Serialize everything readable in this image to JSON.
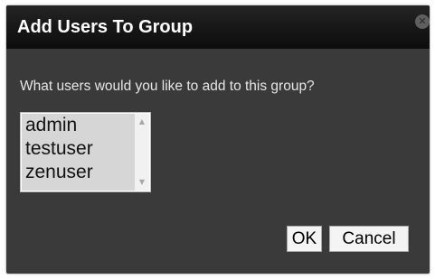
{
  "dialog": {
    "title": "Add Users To Group",
    "close_icon": "close-icon",
    "prompt": "What users would you like to add to this group?",
    "users": [
      {
        "label": "admin"
      },
      {
        "label": "testuser"
      },
      {
        "label": "zenuser"
      }
    ],
    "ok_label": "OK",
    "cancel_label": "Cancel"
  },
  "colors": {
    "dialog_background": "#3a3a3a",
    "titlebar_background": "#161616",
    "selected_option_background": "#d6d6d6"
  }
}
